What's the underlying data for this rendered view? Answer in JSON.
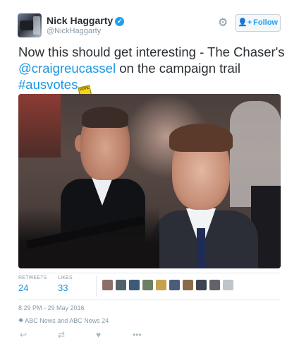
{
  "user": {
    "name": "Nick Haggarty",
    "handle": "@NickHaggarty",
    "verified": true
  },
  "follow_button": {
    "label": "Follow"
  },
  "tweet": {
    "text_before": "Now this should get interesting - The Chaser's ",
    "mention": "@craigreucassel",
    "text_middle": " on the campaign trail ",
    "hashtag": "#ausvotes",
    "flag_text": "VOTE"
  },
  "stats": {
    "retweets_label": "RETWEETS",
    "retweets_value": "24",
    "likes_label": "LIKES",
    "likes_value": "33",
    "liker_colors": [
      "#8c6f6a",
      "#51626b",
      "#3d5a78",
      "#6d7f64",
      "#c6a14e",
      "#495d7a",
      "#8a6c4a",
      "#3c4550",
      "#65616a",
      "#bfc4c8"
    ]
  },
  "meta": {
    "timestamp": "8:29 PM - 29 May 2016",
    "source": "ABC News and ABC News 24"
  },
  "colors": {
    "link": "#1b95e0",
    "muted": "#8899a6",
    "verified": "#1da1f2"
  }
}
